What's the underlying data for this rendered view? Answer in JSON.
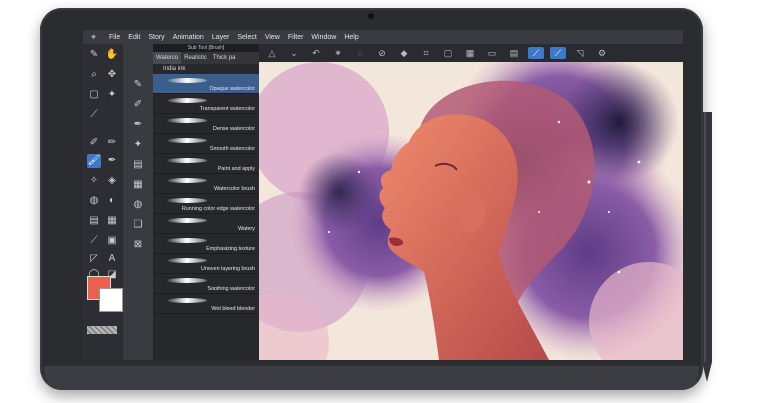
{
  "menu": {
    "items": [
      "File",
      "Edit",
      "Story",
      "Animation",
      "Layer",
      "Select",
      "View",
      "Filter",
      "Window",
      "Help"
    ]
  },
  "sub_tool": {
    "header": "Sub Tool [Brush]",
    "tabs": [
      "Waterco",
      "Realistic",
      "Thick pa"
    ],
    "ink": "India ink",
    "brushes": [
      {
        "label": "Opaque watercolor",
        "selected": true
      },
      {
        "label": "Transparent watercolor",
        "selected": false
      },
      {
        "label": "Dense watercolor",
        "selected": false
      },
      {
        "label": "Smooth watercolor",
        "selected": false
      },
      {
        "label": "Paint and apply",
        "selected": false
      },
      {
        "label": "Watercolor brush",
        "selected": false
      },
      {
        "label": "Running color edge watercolor",
        "selected": false
      },
      {
        "label": "Watery",
        "selected": false
      },
      {
        "label": "Emphasizing texture",
        "selected": false
      },
      {
        "label": "Uneven layering brush",
        "selected": false
      },
      {
        "label": "Soothing watercolor",
        "selected": false
      },
      {
        "label": "Wet bleed blender",
        "selected": false
      }
    ]
  },
  "colors": {
    "main": "#e9604f",
    "sub": "#ffffff",
    "accent": "#3e78c8",
    "ui_dark": "#2d2e33"
  },
  "tools_text": {
    "text_tool": "A"
  }
}
